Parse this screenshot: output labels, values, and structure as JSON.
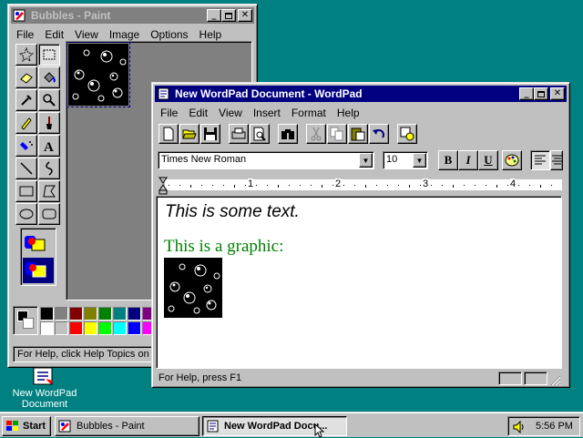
{
  "desktop": {
    "icon_label_line1": "New WordPad",
    "icon_label_line2": "Document"
  },
  "paint": {
    "title": "Bubbles - Paint",
    "menu": [
      "File",
      "Edit",
      "View",
      "Image",
      "Options",
      "Help"
    ],
    "status": "For Help, click Help Topics on",
    "palette_row1": [
      "#000000",
      "#808080",
      "#800000",
      "#808000",
      "#008000",
      "#008080",
      "#000080",
      "#800080"
    ],
    "palette_row2": [
      "#ffffff",
      "#c0c0c0",
      "#ff0000",
      "#ffff00",
      "#00ff00",
      "#00ffff",
      "#0000ff",
      "#ff00ff"
    ]
  },
  "wordpad": {
    "title": "New WordPad Document - WordPad",
    "menu": [
      "File",
      "Edit",
      "View",
      "Insert",
      "Format",
      "Help"
    ],
    "font_name": "Times New Roman",
    "font_size": "10",
    "ruler_numbers": [
      "1",
      "2",
      "3",
      "4"
    ],
    "line1": "This is some text.",
    "line2": "This is a graphic:",
    "line2_color": "#008000",
    "status": "For Help, press F1"
  },
  "taskbar": {
    "start": "Start",
    "tasks": [
      "Bubbles - Paint",
      "New WordPad Docu..."
    ],
    "clock": "5:56 PM"
  }
}
